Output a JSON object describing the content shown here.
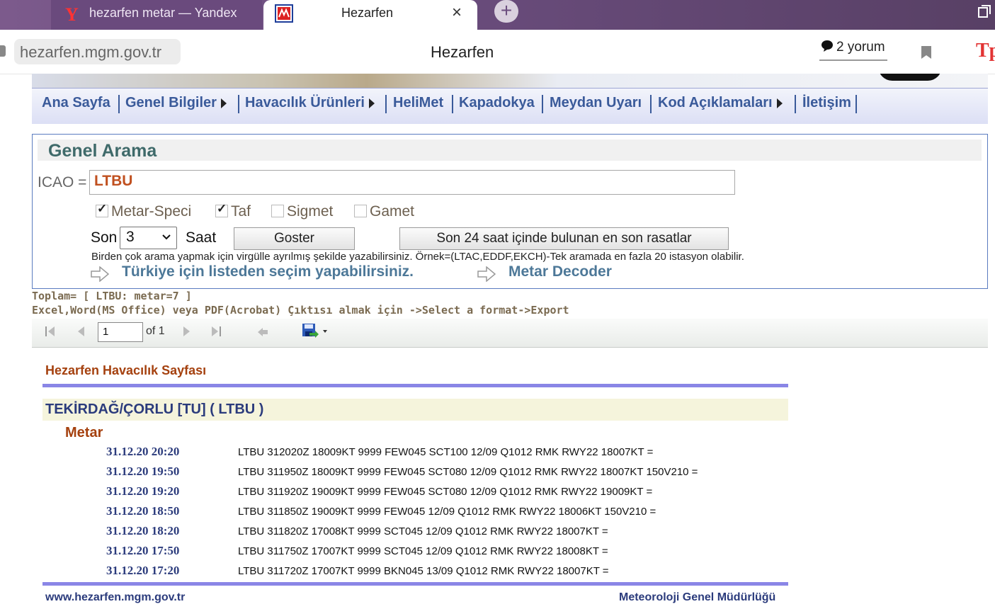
{
  "browser": {
    "tabs": [
      {
        "title": "hezarfen metar — Yandex"
      },
      {
        "title": "Hezarfen",
        "close": "×"
      }
    ],
    "new_tab": "+",
    "url": "hezarfen.mgm.gov.tr",
    "page_title": "Hezarfen",
    "comments": "2 yorum"
  },
  "menu": {
    "items": [
      "Ana Sayfa",
      "Genel Bilgiler",
      "Havacılık Ürünleri",
      "HeliMet",
      "Kapadokya",
      "Meydan Uyarı",
      "Kod Açıklamaları",
      "İletişim"
    ]
  },
  "search": {
    "heading": "Genel Arama",
    "icao_label": "ICAO =",
    "icao_value": "LTBU",
    "checkboxes": [
      {
        "label": "Metar-Speci",
        "checked": true
      },
      {
        "label": "Taf",
        "checked": true
      },
      {
        "label": "Sigmet",
        "checked": false
      },
      {
        "label": "Gamet",
        "checked": false
      }
    ],
    "son_label": "Son",
    "son_value": "3",
    "saat_label": "Saat",
    "goster_button": "Goster",
    "last24_button": "Son 24 saat içinde bulunan en son rasatlar",
    "hint": "Birden çok arama yapmak için virgülle ayrılmış şekilde yazabilirsiniz. Örnek=(LTAC,EDDF,EKCH)-Tek aramada en fazla 20 istasyon olabilir.",
    "list_link": "Türkiye için listeden seçim yapabilirsiniz.",
    "decoder_link": "Metar Decoder"
  },
  "summary": {
    "total": "Toplam= [ LTBU: metar=7 ]",
    "export_hint": "Excel,Word(MS Office) veya PDF(Acrobat) Çıktısı almak için ->Select a format->Export"
  },
  "toolbar": {
    "page_value": "1",
    "of_label": "of 1"
  },
  "report": {
    "title": "Hezarfen Havacılık Sayfası",
    "station": "TEKİRDAĞ/ÇORLU [TU] ( LTBU )",
    "section": "Metar",
    "rows": [
      {
        "date": "31.12.20 20:20",
        "text": "LTBU 312020Z 18009KT 9999 FEW045 SCT100 12/09 Q1012 RMK RWY22 18007KT ="
      },
      {
        "date": "31.12.20 19:50",
        "text": "LTBU 311950Z 18009KT 9999 FEW045 SCT080 12/09 Q1012 RMK RWY22 18007KT 150V210 ="
      },
      {
        "date": "31.12.20 19:20",
        "text": "LTBU 311920Z 19009KT 9999 FEW045 SCT080 12/09 Q1012 RMK RWY22 19009KT ="
      },
      {
        "date": "31.12.20 18:50",
        "text": "LTBU 311850Z 19009KT 9999 FEW045 12/09 Q1012 RMK RWY22 18006KT 150V210 ="
      },
      {
        "date": "31.12.20 18:20",
        "text": "LTBU 311820Z 17008KT 9999 SCT045 12/09 Q1012 RMK RWY22 18007KT ="
      },
      {
        "date": "31.12.20 17:50",
        "text": "LTBU 311750Z 17007KT 9999 SCT045 12/09 Q1012 RMK RWY22 18008KT ="
      },
      {
        "date": "31.12.20 17:20",
        "text": "LTBU 311720Z 17007KT 9999 BKN045 13/09 Q1012 RMK RWY22 18007KT ="
      }
    ],
    "footer_left": "www.hezarfen.mgm.gov.tr",
    "footer_right": "Meteoroloji Genel Müdürlüğü"
  },
  "colors": {
    "tabbar": "#6b4d7e",
    "menu_link": "#3a5a9a",
    "report_accent": "#a5410f",
    "report_bar": "#8a86e6"
  }
}
